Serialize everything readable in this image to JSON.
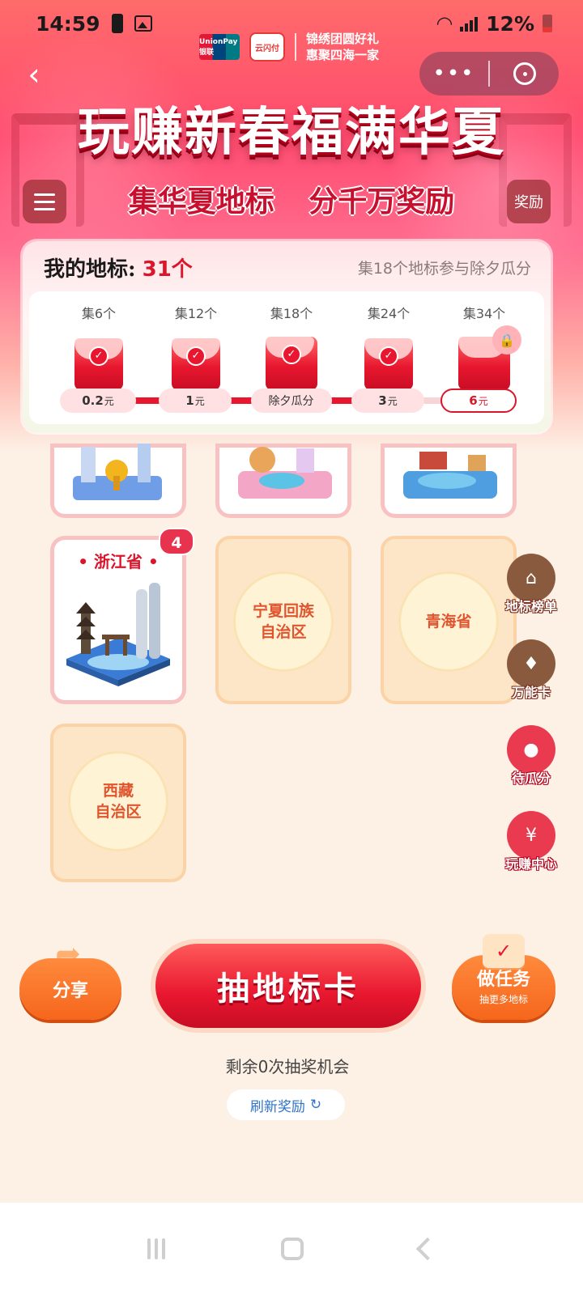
{
  "status_bar": {
    "time": "14:59",
    "battery_percent": "12%",
    "icons": [
      "battery-alert-icon",
      "image-icon",
      "wifi-icon",
      "signal-icon",
      "battery-icon"
    ]
  },
  "brand": {
    "unionpay": "UnionPay 银联",
    "yun": "云闪付",
    "slogan_line1": "锦绣团圆好礼",
    "slogan_line2": "惠聚四海一家"
  },
  "capsule": {
    "more": "•••"
  },
  "title": "玩赚新春福满华夏",
  "subtitle": "集华夏地标 分千万奖励",
  "reward_button": "奖励",
  "progress": {
    "title": "我的地标:",
    "count": "31个",
    "hint": "集18个地标参与除夕瓜分",
    "milestones": [
      {
        "label": "集6个",
        "amount": "0.2",
        "unit": "元",
        "done": true
      },
      {
        "label": "集12个",
        "amount": "1",
        "unit": "元",
        "done": true
      },
      {
        "label": "集18个",
        "amount": "除夕瓜分",
        "unit": "",
        "done": true
      },
      {
        "label": "集24个",
        "amount": "3",
        "unit": "元",
        "done": true
      },
      {
        "label": "集34个",
        "amount": "6",
        "unit": "元",
        "done": false
      }
    ]
  },
  "landmarks": {
    "zhejiang": {
      "name": "浙江省",
      "count": "4"
    },
    "ningxia": {
      "line1": "宁夏回族",
      "line2": "自治区"
    },
    "qinghai": {
      "line1": "青海省"
    },
    "xizang": {
      "line1": "西藏",
      "line2": "自治区"
    }
  },
  "side_menu": {
    "ranking": "地标榜单",
    "wildcard": "万能卡",
    "pending": "待瓜分",
    "center": "玩赚中心"
  },
  "actions": {
    "share": "分享",
    "draw": "抽地标卡",
    "task_main": "做任务",
    "task_sub": "抽更多地标"
  },
  "remaining": "剩余0次抽奖机会",
  "refresh": "刷新奖励",
  "colors": {
    "primary_red": "#e8172f",
    "orange": "#f5661c",
    "background": "#fdf1e6",
    "link_blue": "#2f74c8"
  }
}
